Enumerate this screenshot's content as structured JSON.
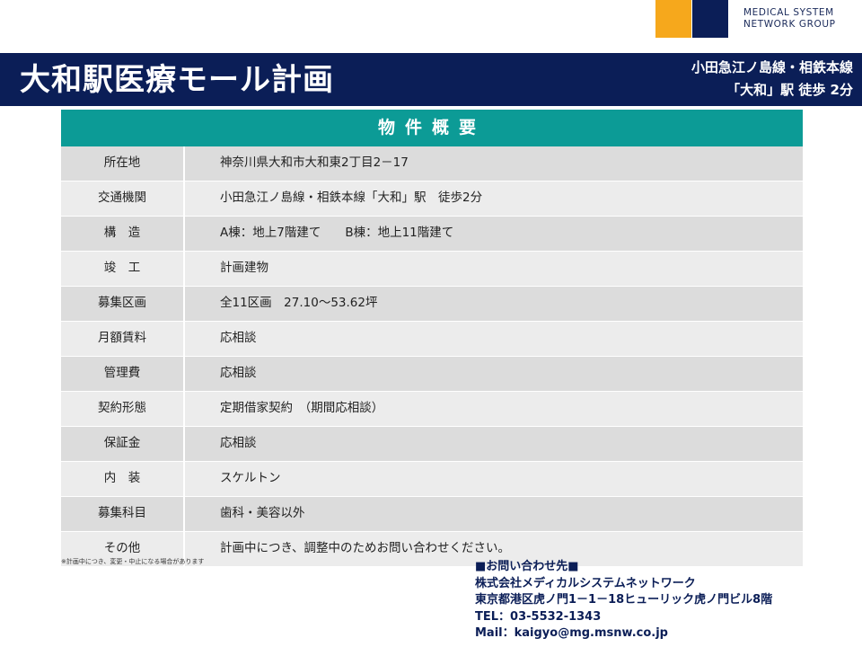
{
  "logo": {
    "line1": "MEDICAL SYSTEM",
    "line2": "NETWORK GROUP",
    "colors": {
      "orange": "#f6a81c",
      "navy": "#0b1e57"
    }
  },
  "header": {
    "title": "大和駅医療モール計画",
    "access_line1": "小田急江ノ島線・相鉄本線",
    "access_line2": "「大和」駅 徒歩 2分"
  },
  "table": {
    "heading": "物件概要",
    "rows": [
      {
        "label": "所在地",
        "value": "神奈川県大和市大和東2丁目2－17"
      },
      {
        "label": "交通機関",
        "value": "小田急江ノ島線・相鉄本線「大和」駅　徒歩2分"
      },
      {
        "label": "構　造",
        "value": "A棟：地上7階建て　　B棟：地上11階建て"
      },
      {
        "label": "竣　工",
        "value": "計画建物"
      },
      {
        "label": "募集区画",
        "value": "全11区画　27.10～53.62坪"
      },
      {
        "label": "月額賃料",
        "value": "応相談"
      },
      {
        "label": "管理費",
        "value": "応相談"
      },
      {
        "label": "契約形態",
        "value": "定期借家契約　（期間応相談）"
      },
      {
        "label": "保証金",
        "value": "応相談"
      },
      {
        "label": "内　装",
        "value": "スケルトン"
      },
      {
        "label": "募集科目",
        "value": "歯科・美容以外"
      },
      {
        "label": "その他",
        "value": "計画中につき、調整中のためお問い合わせください。"
      }
    ]
  },
  "note": "※計画中につき、変更・中止になる場合があります",
  "contact": {
    "heading": "■お問い合わせ先■",
    "company": "株式会社メディカルシステムネットワーク",
    "address": "東京都港区虎ノ門1－1－18ヒューリック虎ノ門ビル8階",
    "tel": "TEL：03-5532-1343",
    "mail": "Mail：kaigyo@mg.msnw.co.jp"
  }
}
